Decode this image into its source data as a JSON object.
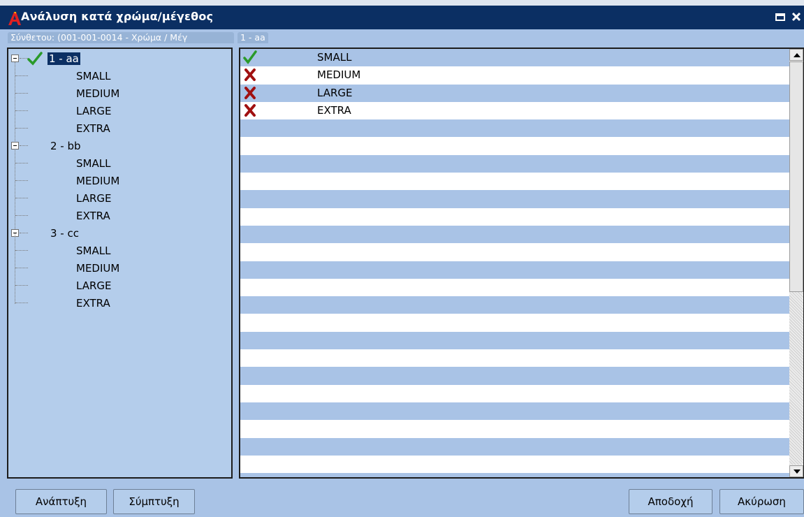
{
  "window": {
    "title": "Ανάλυση κατά χρώμα/μέγεθος"
  },
  "groups": {
    "left_label": "Σύνθετου: (001-001-0014 - Χρώμα / Μέγ",
    "right_label": "1 - aa"
  },
  "tree": {
    "nodes": [
      {
        "label": "1 - aa",
        "checked": true,
        "selected": true,
        "children": [
          "SMALL",
          "MEDIUM",
          "LARGE",
          "EXTRA"
        ]
      },
      {
        "label": "2 - bb",
        "checked": false,
        "selected": false,
        "children": [
          "SMALL",
          "MEDIUM",
          "LARGE",
          "EXTRA"
        ]
      },
      {
        "label": "3 - cc",
        "checked": false,
        "selected": false,
        "children": [
          "SMALL",
          "MEDIUM",
          "LARGE",
          "EXTRA"
        ]
      }
    ]
  },
  "list": {
    "items": [
      {
        "label": "SMALL",
        "status": "check-icon",
        "selected": true
      },
      {
        "label": "MEDIUM",
        "status": "cross-icon",
        "selected": false
      },
      {
        "label": "LARGE",
        "status": "cross-icon",
        "selected": false
      },
      {
        "label": "EXTRA",
        "status": "cross-icon",
        "selected": false
      }
    ]
  },
  "buttons": {
    "expand": "Ανάπτυξη",
    "collapse": "Σύμπτυξη",
    "accept": "Αποδοχή",
    "cancel": "Ακύρωση"
  },
  "colors": {
    "titlebar": "#0b2f63",
    "row_alt": "#a9c3e6",
    "check": "#2a9a2a",
    "cross": "#a01010"
  }
}
